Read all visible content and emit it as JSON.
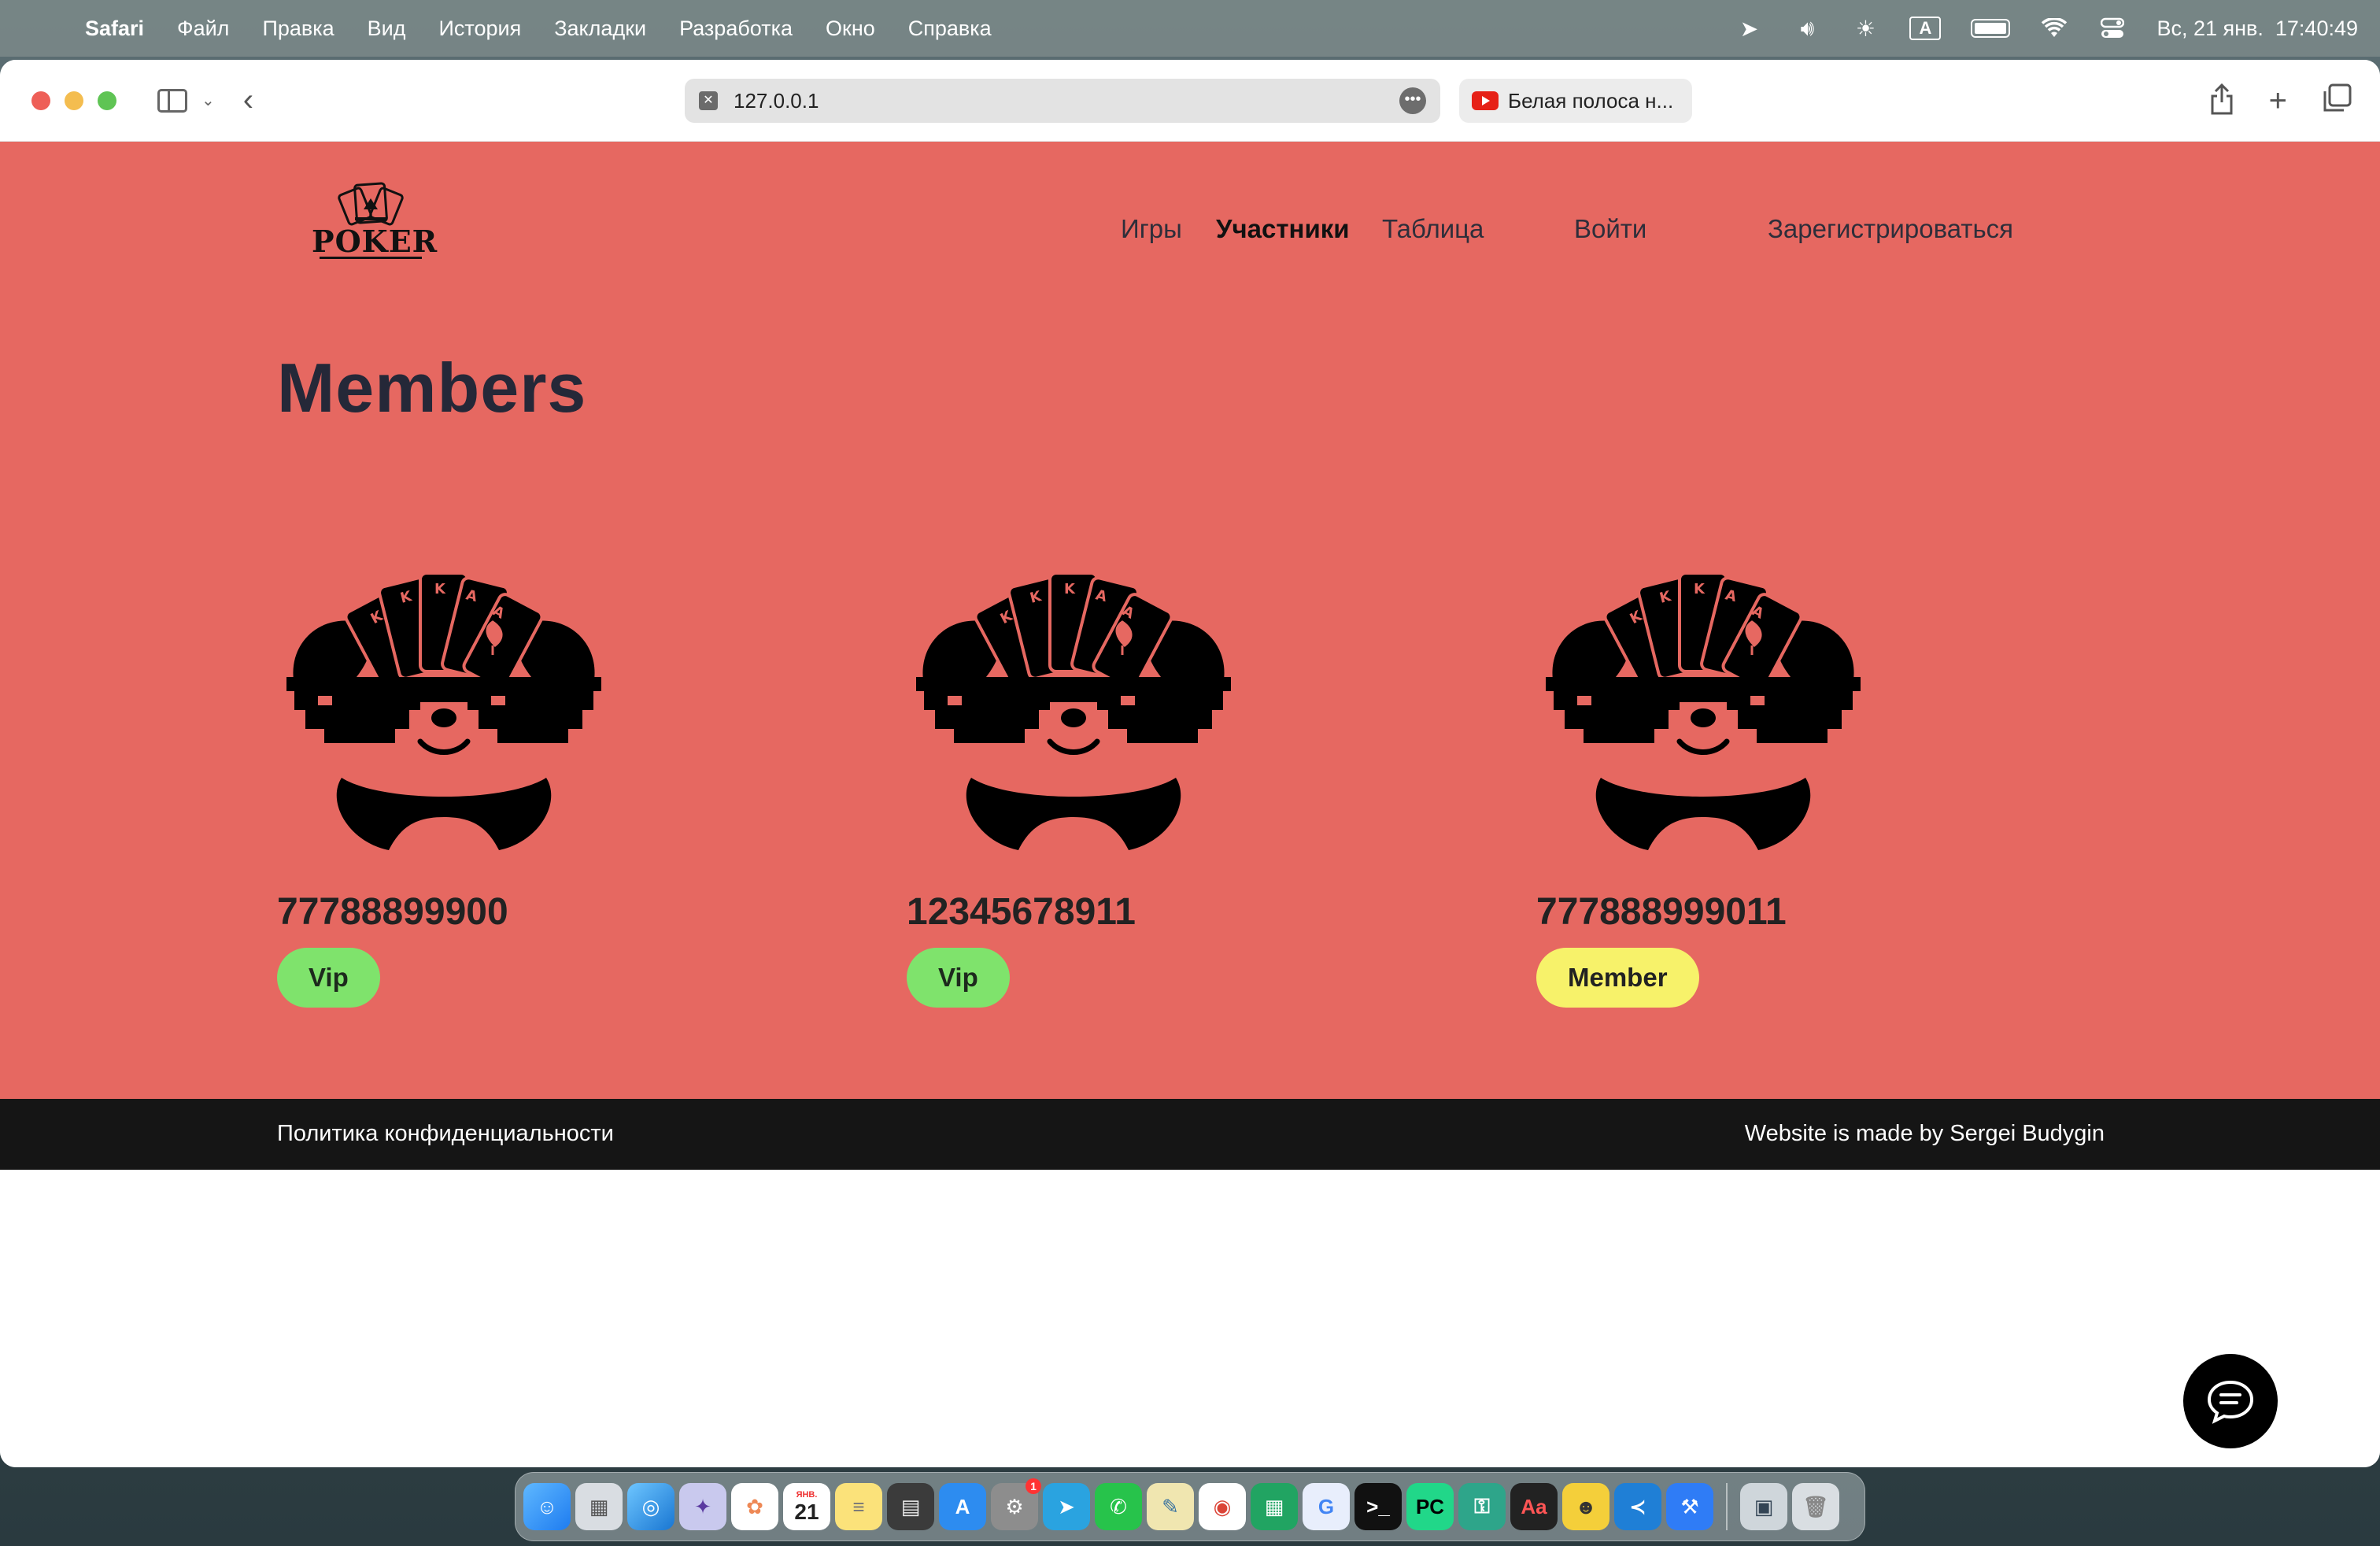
{
  "menubar": {
    "app": "Safari",
    "items": [
      "Файл",
      "Правка",
      "Вид",
      "История",
      "Закладки",
      "Разработка",
      "Окно",
      "Справка"
    ],
    "datetime": "Вс, 21 янв.  17:40:49",
    "input_source": "A"
  },
  "browser": {
    "url": "127.0.0.1",
    "second_tab": "Белая полоса н..."
  },
  "site": {
    "logo_text": "POKER",
    "nav": {
      "games": "Игры",
      "members": "Участники",
      "table": "Таблица",
      "login": "Войти",
      "register": "Зарегистрироваться"
    },
    "page_title": "Members",
    "members": [
      {
        "phone": "77788899900",
        "status": "Vip"
      },
      {
        "phone": "12345678911",
        "status": "Vip"
      },
      {
        "phone": "777888999011",
        "status": "Member"
      }
    ],
    "footer": {
      "privacy": "Политика конфиденциальности",
      "credit": "Website is made by Sergei Budygin"
    }
  },
  "colors": {
    "hero_bg": "#e66861",
    "vip_badge": "#7fe36c",
    "member_badge": "#f7f26a",
    "footer_bg": "#151515"
  },
  "dock": {
    "calendar_month": "ЯНВ.",
    "calendar_day": "21",
    "settings_badge": "1"
  }
}
